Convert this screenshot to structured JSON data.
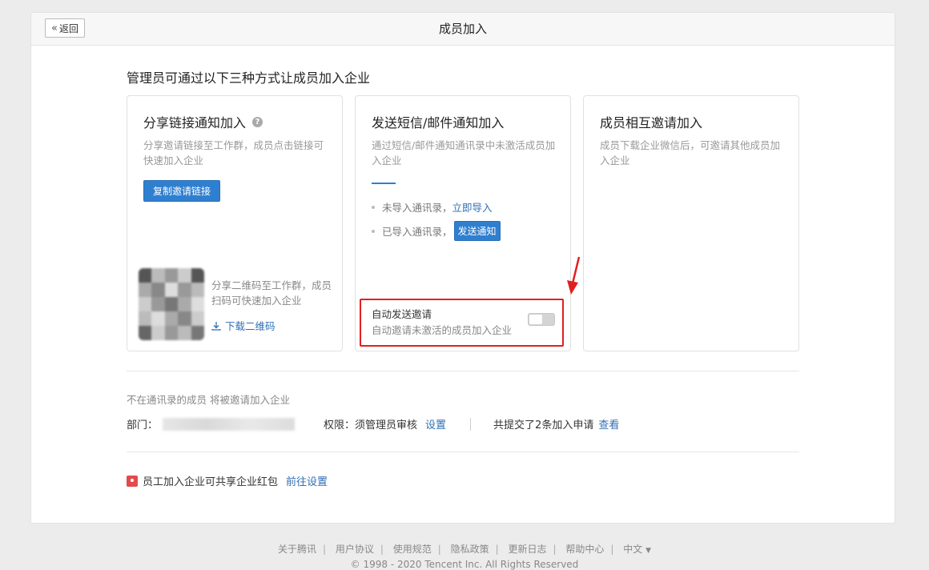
{
  "header": {
    "back_label": "返回",
    "title": "成员加入"
  },
  "intro": "管理员可通过以下三种方式让成员加入企业",
  "cards": {
    "share": {
      "title": "分享链接通知加入",
      "desc": "分享邀请链接至工作群，成员点击链接可快速加入企业",
      "copy_button": "复制邀请链接",
      "qr_text": "分享二维码至工作群，成员扫码可快速加入企业",
      "download_label": "下载二维码"
    },
    "sms": {
      "title": "发送短信/邮件通知加入",
      "desc": "通过短信/邮件通知通讯录中未激活成员加入企业",
      "bullet1_text": "未导入通讯录，",
      "bullet1_link": "立即导入",
      "bullet2_text": "已导入通讯录，",
      "bullet2_button": "发送通知",
      "auto_invite_title": "自动发送邀请",
      "auto_invite_desc": "自动邀请未激活的成员加入企业",
      "auto_invite_on": false
    },
    "mutual": {
      "title": "成员相互邀请加入",
      "desc": "成员下载企业微信后，可邀请其他成员加入企业"
    }
  },
  "settings": {
    "note": "不在通讯录的成员 将被邀请加入企业",
    "dept_label": "部门：",
    "permission_label": "权限：须管理员审核",
    "permission_link": "设置",
    "applications_text": "共提交了2条加入申请",
    "applications_link": "查看"
  },
  "redpacket": {
    "text": "员工加入企业可共享企业红包",
    "link": "前往设置"
  },
  "footer": {
    "links": [
      "关于腾讯",
      "用户协议",
      "使用规范",
      "隐私政策",
      "更新日志",
      "帮助中心",
      "中文"
    ],
    "copyright": "© 1998 - 2020 Tencent Inc. All Rights Reserved"
  },
  "colors": {
    "accent": "#2f7fd0",
    "highlight": "#e02020"
  }
}
